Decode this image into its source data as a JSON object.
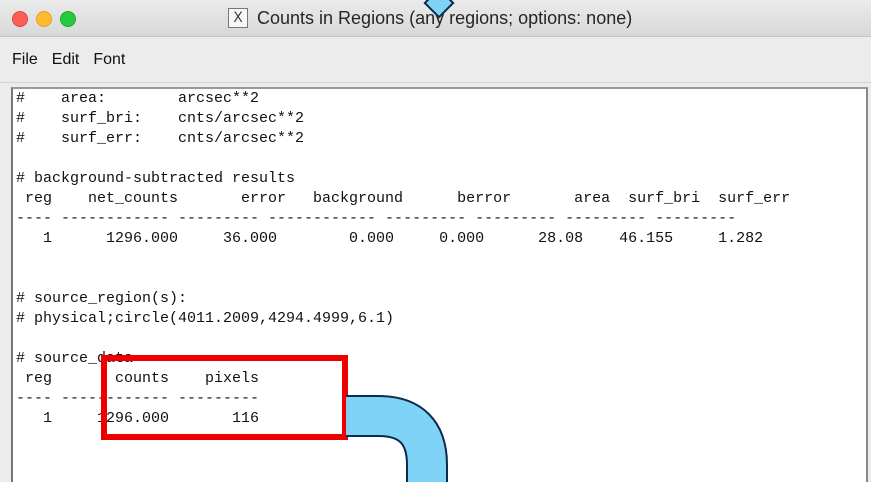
{
  "window": {
    "title": "Counts in Regions (any regions; options: none)",
    "title_icon": "X"
  },
  "menu": {
    "file": "File",
    "edit": "Edit",
    "font": "Font"
  },
  "report": {
    "lines": [
      "#    area:        arcsec**2",
      "#    surf_bri:    cnts/arcsec**2",
      "#    surf_err:    cnts/arcsec**2",
      "",
      "# background-subtracted results",
      " reg    net_counts       error   background      berror       area  surf_bri  surf_err",
      "---- ------------ --------- ------------ --------- --------- --------- ---------",
      "   1      1296.000     36.000        0.000     0.000      28.08    46.155     1.282",
      "",
      "",
      "# source_region(s):",
      "# physical;circle(4011.2009,4294.4999,6.1)",
      "",
      "# source_data",
      " reg       counts    pixels",
      "---- ------------ ---------",
      "   1     1296.000       116"
    ]
  },
  "annotation": {
    "box_color": "#ee0000",
    "connector_color": "#7fd3f7",
    "connector_outline": "#0d2c4c"
  }
}
